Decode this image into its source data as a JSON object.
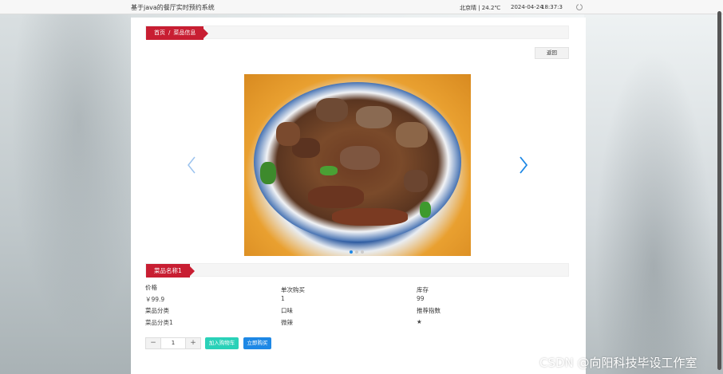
{
  "topbar": {
    "title": "基于java的餐厅实时预约系统",
    "weather": "北京晴 | 24.2℃",
    "date": "2024-04-24",
    "time": "18:37:3"
  },
  "breadcrumb": {
    "home": "首页",
    "sep": "/",
    "current": "菜品信息"
  },
  "back_button": "返回",
  "carousel": {
    "dot_count": 3,
    "active_dot": 0
  },
  "dish": {
    "name": "菜品名称1",
    "fields": [
      {
        "label": "价格",
        "value": "￥99.9"
      },
      {
        "label": "单次购买",
        "value": "1"
      },
      {
        "label": "库存",
        "value": "99"
      },
      {
        "label": "菜品分类",
        "value": "菜品分类1"
      },
      {
        "label": "口味",
        "value": "微辣"
      },
      {
        "label": "推荐指数",
        "value": "★"
      }
    ]
  },
  "stepper": {
    "minus": "−",
    "value": "1",
    "plus": "+"
  },
  "actions": {
    "add_cart": "加入购物车",
    "buy_now": "立即购买"
  },
  "watermark": "CSDN @向阳科技毕设工作室",
  "colors": {
    "accent_red": "#c81e32",
    "teal": "#2ad1b8",
    "blue": "#1e88e5"
  }
}
